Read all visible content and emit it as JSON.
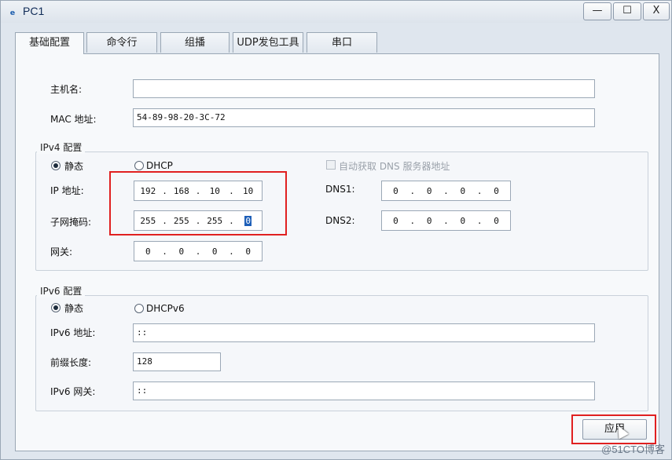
{
  "window": {
    "title": "PC1",
    "minimize": "—",
    "maximize": "☐",
    "close": "X"
  },
  "tabs": [
    "基础配置",
    "命令行",
    "组播",
    "UDP发包工具",
    "串口"
  ],
  "basic": {
    "hostname_label": "主机名:",
    "hostname_value": "",
    "mac_label": "MAC 地址:",
    "mac_value": "54-89-98-20-3C-72"
  },
  "ipv4": {
    "group_title": "IPv4 配置",
    "static_label": "静态",
    "dhcp_label": "DHCP",
    "dns_auto_label": "自动获取 DNS 服务器地址",
    "ip_label": "IP 地址:",
    "ip": [
      "192",
      "168",
      "10",
      "10"
    ],
    "mask_label": "子网掩码:",
    "mask": [
      "255",
      "255",
      "255",
      "0"
    ],
    "gateway_label": "网关:",
    "gateway": [
      "0",
      "0",
      "0",
      "0"
    ],
    "dns1_label": "DNS1:",
    "dns1": [
      "0",
      "0",
      "0",
      "0"
    ],
    "dns2_label": "DNS2:",
    "dns2": [
      "0",
      "0",
      "0",
      "0"
    ]
  },
  "ipv6": {
    "group_title": "IPv6 配置",
    "static_label": "静态",
    "dhcp_label": "DHCPv6",
    "ip_label": "IPv6 地址:",
    "ip_value": "::",
    "prefix_label": "前缀长度:",
    "prefix_value": "128",
    "gateway_label": "IPv6 网关:",
    "gateway_value": "::"
  },
  "apply_label": "应用",
  "watermark": "@51CTO博客"
}
